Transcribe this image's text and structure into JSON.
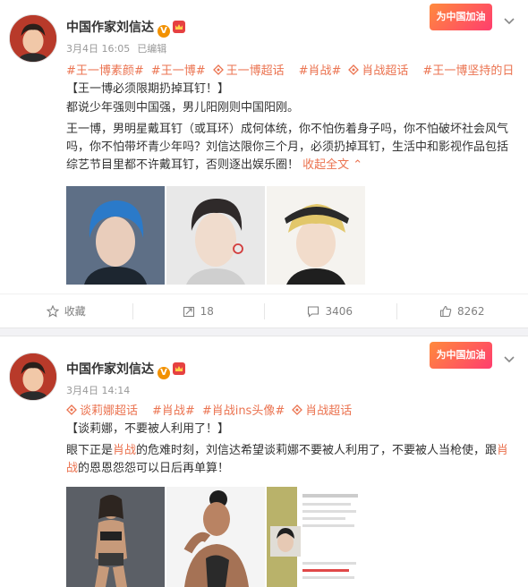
{
  "posts": [
    {
      "author": "中国作家刘信达",
      "vbadge": "V",
      "date": "3月4日 16:05",
      "edited": "已编辑",
      "promo": "为中国加油",
      "tags": [
        "#王一博素颜#",
        "#王一博#",
        "王一博超话",
        "#肖战#",
        "肖战超话",
        "#王一博坚持的日常#"
      ],
      "title": "【王一博必须限期扔掉耳钉！】",
      "para1": "都说少年强则中国强，男儿阳刚则中国阳刚。",
      "para2": "王一博，男明星戴耳钉（或耳环）成何体统，你不怕伤着身子吗，你不怕破坏社会风气吗，你不怕带坏青少年吗？刘信达限你三个月，必须扔掉耳钉，生活中和影视作品包括综艺节目里都不许戴耳钉，否则逐出娱乐圈！",
      "collapse": "收起全文 ⌃",
      "actions": {
        "favorite": "收藏",
        "repost": "18",
        "comment": "3406",
        "like": "8262"
      }
    },
    {
      "author": "中国作家刘信达",
      "vbadge": "V",
      "date": "3月4日 14:14",
      "promo": "为中国加油",
      "tags": [
        "谈莉娜超话",
        "#肖战#",
        "#肖战ins头像#",
        "肖战超话"
      ],
      "title": "【谈莉娜，不要被人利用了！】",
      "para_a": "眼下正是",
      "para_hl1": "肖战",
      "para_b": "的危难时刻，刘信达希望谈莉娜不要被人利用了，不要被人当枪使，跟",
      "para_hl2": "肖战",
      "para_c": "的恩恩怨怨可以日后再单算！"
    }
  ]
}
